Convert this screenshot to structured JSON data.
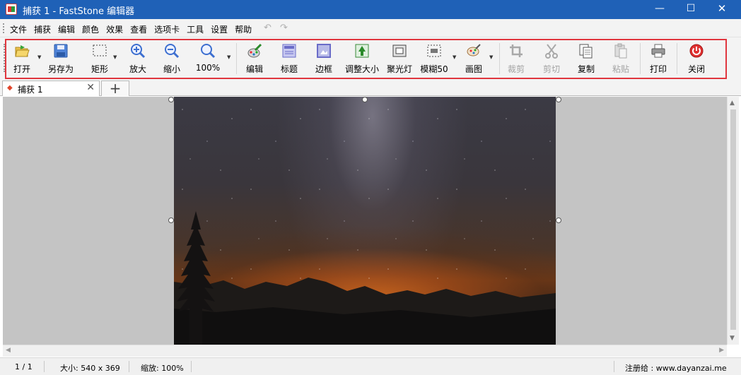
{
  "window": {
    "title": "捕获 1 - FastStone 编辑器",
    "minimize_glyph": "—",
    "maximize_glyph": "☐",
    "close_glyph": "✕"
  },
  "menu": {
    "items": [
      "文件",
      "捕获",
      "编辑",
      "颜色",
      "效果",
      "查看",
      "选项卡",
      "工具",
      "设置",
      "帮助"
    ],
    "undo_glyph": "↶",
    "redo_glyph": "↷"
  },
  "toolbar": {
    "open": "打开",
    "save_as": "另存为",
    "rectangle": "矩形",
    "zoom_in": "放大",
    "zoom_out": "缩小",
    "zoom_100": "100%",
    "edit": "编辑",
    "caption": "标题",
    "border": "边框",
    "resize": "调整大小",
    "spotlight": "聚光灯",
    "blur": "模糊50",
    "draw": "画图",
    "crop": "裁剪",
    "cut": "剪切",
    "copy": "复制",
    "paste": "粘贴",
    "print": "打印",
    "close": "关闭",
    "disabled": [
      "crop",
      "cut",
      "paste"
    ],
    "icons": [
      "open-folder-icon",
      "save-disk-icon",
      "rectangle-select-icon",
      "zoom-in-icon",
      "zoom-out-icon",
      "zoom-actual-icon",
      "edit-palette-icon",
      "caption-icon",
      "border-icon",
      "resize-icon",
      "spotlight-icon",
      "blur-icon",
      "draw-icon",
      "crop-icon",
      "scissors-icon",
      "copy-icon",
      "paste-icon",
      "printer-icon",
      "power-icon"
    ]
  },
  "tabs": {
    "items": [
      {
        "label": "捕获 1",
        "close_glyph": "✕"
      }
    ],
    "new_tab_glyph": "+"
  },
  "status": {
    "page": "1 / 1",
    "size": "大小: 540 x 369",
    "zoom": "缩放: 100%",
    "registered": "注册给 : www.dayanzai.me"
  },
  "colors": {
    "title_bar": "#1f61b7",
    "highlight_border": "#e0363e",
    "canvas_background": "#c4c4c4"
  }
}
